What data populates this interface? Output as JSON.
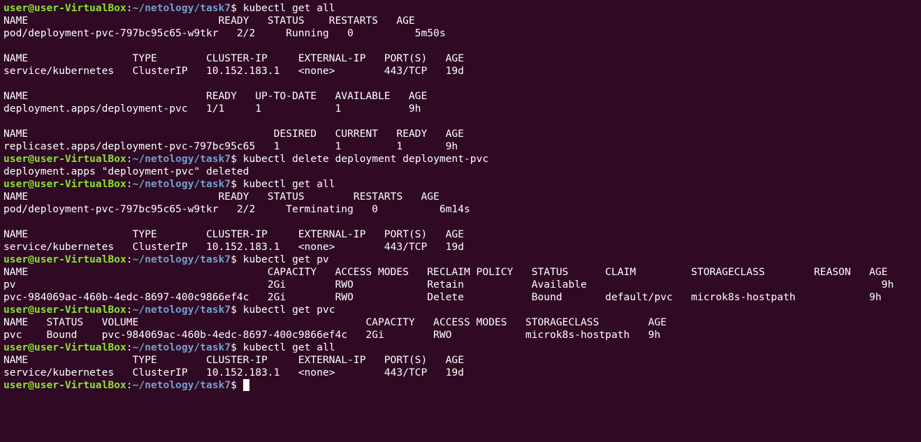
{
  "prompt": {
    "user_host": "user@user-VirtualBox",
    "separator": ":",
    "path": "~/netology/task7",
    "symbol": "$ "
  },
  "colors": {
    "background": "#300a24",
    "text": "#ffffff",
    "user_host": "#8ae234",
    "path": "#729fcf",
    "cursor": "#ffffff"
  },
  "lines": [
    {
      "type": "prompt",
      "command": "kubectl get all"
    },
    {
      "type": "output",
      "text": "NAME                               READY   STATUS    RESTARTS   AGE"
    },
    {
      "type": "output",
      "text": "pod/deployment-pvc-797bc95c65-w9tkr   2/2     Running   0          5m50s"
    },
    {
      "type": "output",
      "text": ""
    },
    {
      "type": "output",
      "text": "NAME                 TYPE        CLUSTER-IP     EXTERNAL-IP   PORT(S)   AGE"
    },
    {
      "type": "output",
      "text": "service/kubernetes   ClusterIP   10.152.183.1   <none>        443/TCP   19d"
    },
    {
      "type": "output",
      "text": ""
    },
    {
      "type": "output",
      "text": "NAME                             READY   UP-TO-DATE   AVAILABLE   AGE"
    },
    {
      "type": "output",
      "text": "deployment.apps/deployment-pvc   1/1     1            1           9h"
    },
    {
      "type": "output",
      "text": ""
    },
    {
      "type": "output",
      "text": "NAME                                        DESIRED   CURRENT   READY   AGE"
    },
    {
      "type": "output",
      "text": "replicaset.apps/deployment-pvc-797bc95c65   1         1         1       9h"
    },
    {
      "type": "prompt",
      "command": "kubectl delete deployment deployment-pvc"
    },
    {
      "type": "output",
      "text": "deployment.apps \"deployment-pvc\" deleted"
    },
    {
      "type": "prompt",
      "command": "kubectl get all"
    },
    {
      "type": "output",
      "text": "NAME                               READY   STATUS        RESTARTS   AGE"
    },
    {
      "type": "output",
      "text": "pod/deployment-pvc-797bc95c65-w9tkr   2/2     Terminating   0          6m14s"
    },
    {
      "type": "output",
      "text": ""
    },
    {
      "type": "output",
      "text": "NAME                 TYPE        CLUSTER-IP     EXTERNAL-IP   PORT(S)   AGE"
    },
    {
      "type": "output",
      "text": "service/kubernetes   ClusterIP   10.152.183.1   <none>        443/TCP   19d"
    },
    {
      "type": "prompt",
      "command": "kubectl get pv"
    },
    {
      "type": "output",
      "text": "NAME                                       CAPACITY   ACCESS MODES   RECLAIM POLICY   STATUS      CLAIM         STORAGECLASS        REASON   AGE"
    },
    {
      "type": "output",
      "text": "pv                                         2Gi        RWO            Retain           Available                                                9h"
    },
    {
      "type": "output",
      "text": "pvc-984069ac-460b-4edc-8697-400c9866ef4c   2Gi        RWO            Delete           Bound       default/pvc   microk8s-hostpath            9h"
    },
    {
      "type": "prompt",
      "command": "kubectl get pvc"
    },
    {
      "type": "output",
      "text": "NAME   STATUS   VOLUME                                     CAPACITY   ACCESS MODES   STORAGECLASS        AGE"
    },
    {
      "type": "output",
      "text": "pvc    Bound    pvc-984069ac-460b-4edc-8697-400c9866ef4c   2Gi        RWO            microk8s-hostpath   9h"
    },
    {
      "type": "prompt",
      "command": "kubectl get all"
    },
    {
      "type": "output",
      "text": "NAME                 TYPE        CLUSTER-IP     EXTERNAL-IP   PORT(S)   AGE"
    },
    {
      "type": "output",
      "text": "service/kubernetes   ClusterIP   10.152.183.1   <none>        443/TCP   19d"
    },
    {
      "type": "prompt",
      "command": "",
      "cursor": true
    }
  ]
}
